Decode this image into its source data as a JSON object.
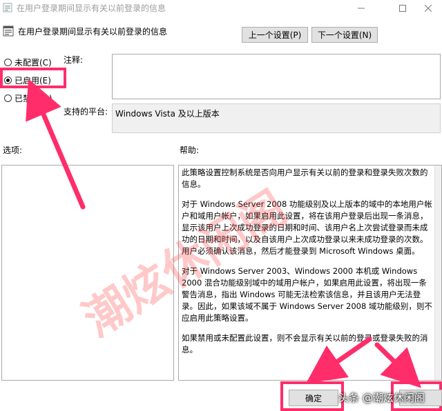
{
  "window": {
    "title": "在用户登录期间显示有关以前登录的信息"
  },
  "header": {
    "setting_name": "在用户登录期间显示有关以前登录的信息",
    "prev_label": "上一个设置(P)",
    "next_label": "下一个设置(N)"
  },
  "radios": [
    {
      "label": "未配置(C)",
      "selected": false
    },
    {
      "label": "已启用(E)",
      "selected": true
    },
    {
      "label": "已禁用(D)",
      "selected": false
    }
  ],
  "comment": {
    "label": "注释:",
    "value": ""
  },
  "platform": {
    "label": "支持的平台:",
    "value": "Windows Vista 及以上版本"
  },
  "options": {
    "label": "选项:"
  },
  "help": {
    "label": "帮助:",
    "paragraphs": [
      "此策略设置控制系统是否向用户显示有关以前的登录和登录失败次数的信息。",
      "对于 Windows Server 2008 功能级别及以上版本的域中的本地用户帐户和域用户帐户，如果启用此设置，将在该用户登录后出现一条消息，显示该用户上次成功登录的日期和时间、该用户名上次尝试登录而未成功的日期和时间，以及自该用户上次成功登录以来未成功登录的次数。用户必须确认该消息，然后才能登录到 Microsoft Windows 桌面。",
      "对于 Windows Server 2003、Windows 2000 本机或 Windows 2000 混合功能级别域中的域用户帐户，如果启用此设置，将出现一条警告消息，指出 Windows 可能无法检索该信息，并且该用户无法登录。因此，如果该域不属于 Windows Server 2008 域功能级别，则不应启用此策略设置。",
      "如果禁用或未配置此设置，则不会显示有关以前的登录或登录失败的消息。"
    ]
  },
  "footer": {
    "ok_label": "确定"
  },
  "overlay": {
    "watermark": "潮炫休闲阁",
    "credit": "头条 @潮炫休闲阁"
  },
  "colors": {
    "highlight": "#ff2d6a",
    "watermark": "#ff3c3c"
  }
}
